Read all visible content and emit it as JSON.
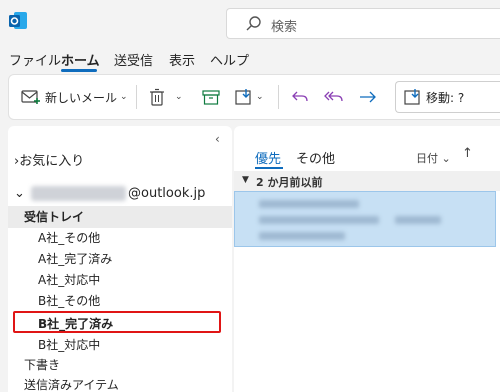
{
  "search": {
    "placeholder": "検索"
  },
  "tabs": [
    "ファイル",
    "ホーム",
    "送受信",
    "表示",
    "ヘルプ"
  ],
  "ribbon": {
    "new_mail_label": "新しいメール",
    "move_label": "移動: ?"
  },
  "folders": {
    "favorites": "お気に入り",
    "account_suffix": "@outlook.jp",
    "inbox": "受信トレイ",
    "subfolders": [
      "A社_その他",
      "A社_完了済み",
      "A社_対応中",
      "B社_その他",
      "B社_完了済み",
      "B社_対応中"
    ],
    "drafts": "下書き",
    "sent": "送信済みアイテム"
  },
  "message_list": {
    "tab_focused": "優先",
    "tab_other": "その他",
    "sort_label": "日付",
    "group_header": "2 か月前以前"
  },
  "colors": {
    "accent": "#0f6cbd",
    "highlight": "#e01515",
    "selected_msg": "#c7e0f4"
  }
}
